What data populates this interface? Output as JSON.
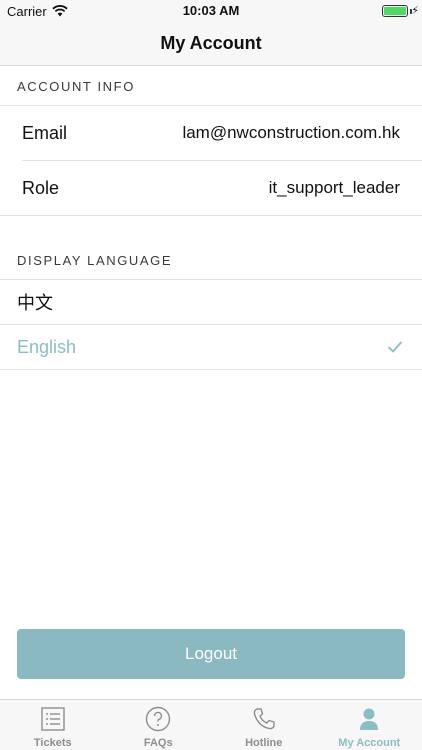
{
  "status_bar": {
    "carrier": "Carrier",
    "time": "10:03 AM"
  },
  "nav": {
    "title": "My Account"
  },
  "account_info": {
    "header": "ACCOUNT INFO",
    "email_label": "Email",
    "email_value": "lam@nwconstruction.com.hk",
    "role_label": "Role",
    "role_value": "it_support_leader"
  },
  "display_language": {
    "header": "DISPLAY LANGUAGE",
    "options": [
      {
        "label": "中文",
        "selected": false
      },
      {
        "label": "English",
        "selected": true
      }
    ]
  },
  "logout_label": "Logout",
  "tabs": [
    {
      "label": "Tickets",
      "icon": "list-icon",
      "active": false
    },
    {
      "label": "FAQs",
      "icon": "question-circle-icon",
      "active": false
    },
    {
      "label": "Hotline",
      "icon": "phone-icon",
      "active": false
    },
    {
      "label": "My Account",
      "icon": "person-icon",
      "active": true
    }
  ],
  "colors": {
    "accent": "#8bbdc4",
    "button": "#8ab9c1",
    "battery": "#4cd964"
  }
}
